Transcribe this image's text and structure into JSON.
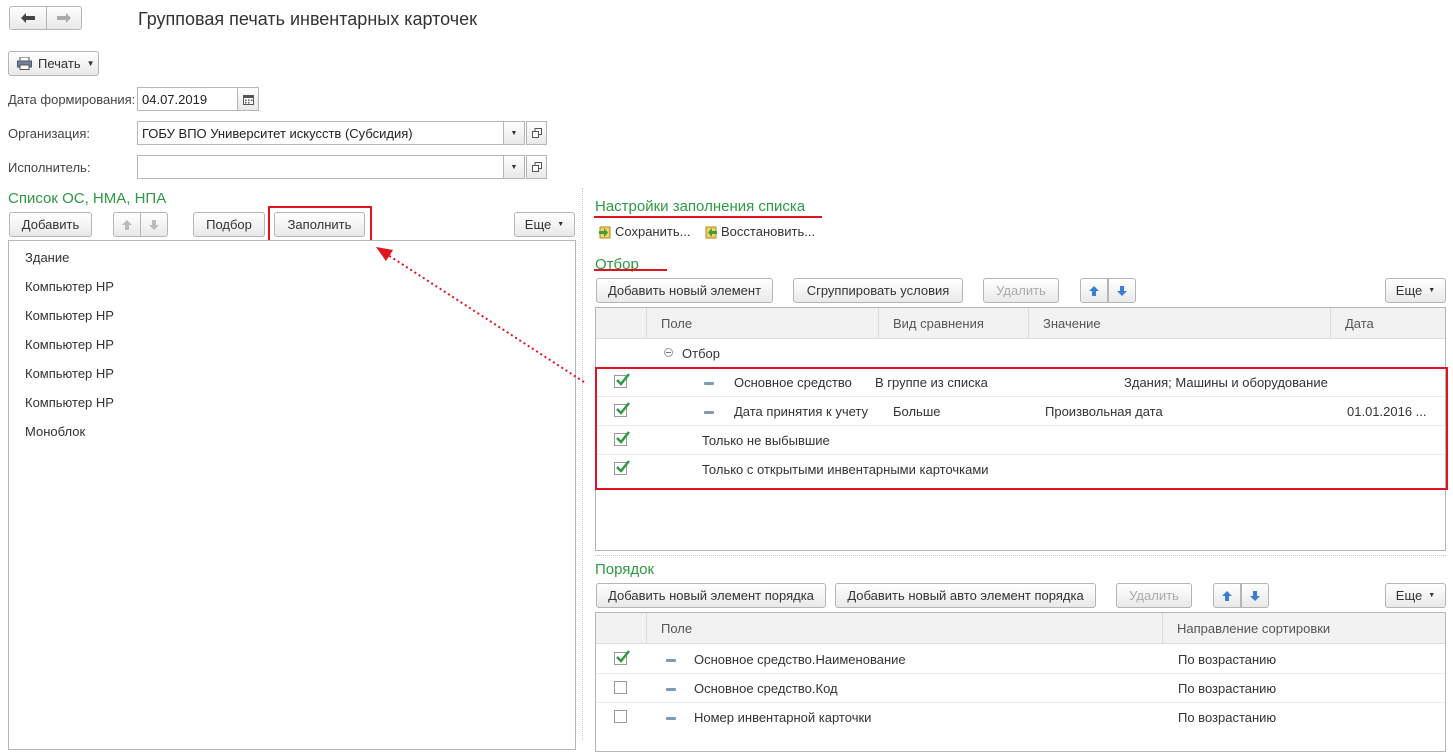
{
  "window": {
    "title": "Групповая печать инвентарных карточек"
  },
  "toolbar": {
    "print_label": "Печать"
  },
  "form": {
    "date_label": "Дата формирования:",
    "date_value": "04.07.2019",
    "org_label": "Организация:",
    "org_value": "ГОБУ ВПО Университет искусств (Субсидия)",
    "executor_label": "Исполнитель:",
    "executor_value": ""
  },
  "left_list": {
    "title": "Список ОС, НМА, НПА",
    "add_label": "Добавить",
    "select_label": "Подбор",
    "fill_label": "Заполнить",
    "more_label": "Еще",
    "items": [
      "Здание",
      "Компьютер HP",
      "Компьютер HP",
      "Компьютер HP",
      "Компьютер HP",
      "Компьютер HP",
      "Моноблок"
    ]
  },
  "settings": {
    "title": "Настройки заполнения списка",
    "save_label": "Сохранить...",
    "restore_label": "Восстановить..."
  },
  "filter": {
    "title": "Отбор",
    "add_label": "Добавить новый элемент",
    "group_label": "Сгруппировать условия",
    "delete_label": "Удалить",
    "more_label": "Еще",
    "columns": [
      "Поле",
      "Вид сравнения",
      "Значение",
      "Дата"
    ],
    "group_row": "Отбор",
    "rows": [
      {
        "checked": true,
        "field": "Основное средство",
        "comparison": "В группе из списка",
        "value": "Здания; Машины и оборудование",
        "date": ""
      },
      {
        "checked": true,
        "field": "Дата принятия к учету",
        "comparison": "Больше",
        "value": "Произвольная дата",
        "date": "01.01.2016 ..."
      },
      {
        "checked": true,
        "field": "Только не выбывшие",
        "comparison": "",
        "value": "",
        "date": ""
      },
      {
        "checked": true,
        "field": "Только с открытыми инвентарными карточками",
        "comparison": "",
        "value": "",
        "date": ""
      }
    ]
  },
  "order": {
    "title": "Порядок",
    "add_label": "Добавить новый элемент порядка",
    "add_auto_label": "Добавить новый авто элемент порядка",
    "delete_label": "Удалить",
    "more_label": "Еще",
    "columns": [
      "Поле",
      "Направление сортировки"
    ],
    "rows": [
      {
        "checked": true,
        "field": "Основное средство.Наименование",
        "direction": "По возрастанию"
      },
      {
        "checked": false,
        "field": "Основное средство.Код",
        "direction": "По возрастанию"
      },
      {
        "checked": false,
        "field": "Номер инвентарной карточки",
        "direction": "По возрастанию"
      }
    ]
  },
  "colors": {
    "accent_green": "#2e9a44",
    "highlight_red": "#e0141e",
    "arrow_blue": "#3a7fd0"
  }
}
